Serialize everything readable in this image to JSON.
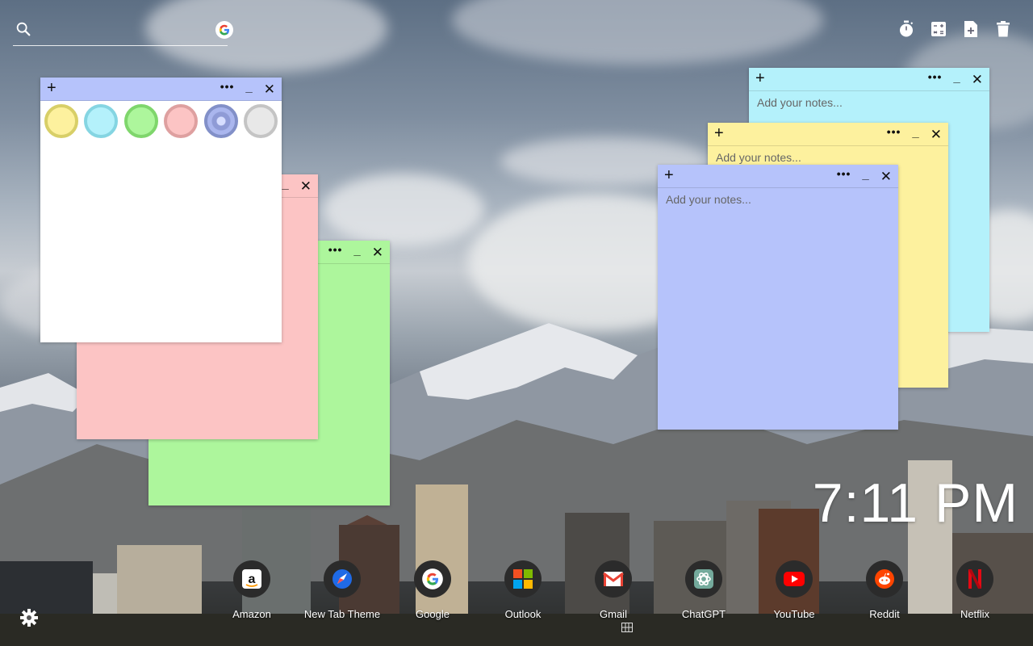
{
  "search": {
    "placeholder": "",
    "value": ""
  },
  "top_tools": [
    "timer-icon",
    "calculator-icon",
    "add-note-icon",
    "trash-icon"
  ],
  "notes": [
    {
      "id": "cyan",
      "color": "#b4f1fb",
      "placeholder": "Add your notes..."
    },
    {
      "id": "yellow",
      "color": "#fdf19e",
      "placeholder": "Add your notes..."
    },
    {
      "id": "blue",
      "color": "#b6c3fb",
      "placeholder": "Add your notes..."
    },
    {
      "id": "green",
      "color": "#adf69c",
      "placeholder": ""
    },
    {
      "id": "pink",
      "color": "#fcc4c4",
      "placeholder": ""
    },
    {
      "id": "white",
      "color": "#ffffff",
      "placeholder": ""
    }
  ],
  "note_controls": {
    "add": "+",
    "more": "•••",
    "minimize": "_",
    "close": "✕"
  },
  "color_swatches": [
    {
      "name": "yellow",
      "fill": "#fdf19e",
      "ring": "#d8cf68"
    },
    {
      "name": "cyan",
      "fill": "#b4f1fb",
      "ring": "#85d5e2"
    },
    {
      "name": "green",
      "fill": "#adf69c",
      "ring": "#7fd66c"
    },
    {
      "name": "pink",
      "fill": "#fcc4c4",
      "ring": "#dea0a0"
    },
    {
      "name": "blue",
      "fill": "#b6c3fb",
      "ring": "#8290c8",
      "selected": true
    },
    {
      "name": "gray",
      "fill": "#e8e8e8",
      "ring": "#c4c4c4"
    }
  ],
  "clock": {
    "time": "7:11 PM"
  },
  "dock": [
    {
      "label": "Amazon",
      "icon": "amazon-icon"
    },
    {
      "label": "New Tab Theme",
      "icon": "new-tab-theme-icon"
    },
    {
      "label": "Google",
      "icon": "google-icon"
    },
    {
      "label": "Outlook",
      "icon": "outlook-icon"
    },
    {
      "label": "Gmail",
      "icon": "gmail-icon"
    },
    {
      "label": "ChatGPT",
      "icon": "chatgpt-icon"
    },
    {
      "label": "YouTube",
      "icon": "youtube-icon"
    },
    {
      "label": "Reddit",
      "icon": "reddit-icon"
    },
    {
      "label": "Netflix",
      "icon": "netflix-icon"
    }
  ]
}
